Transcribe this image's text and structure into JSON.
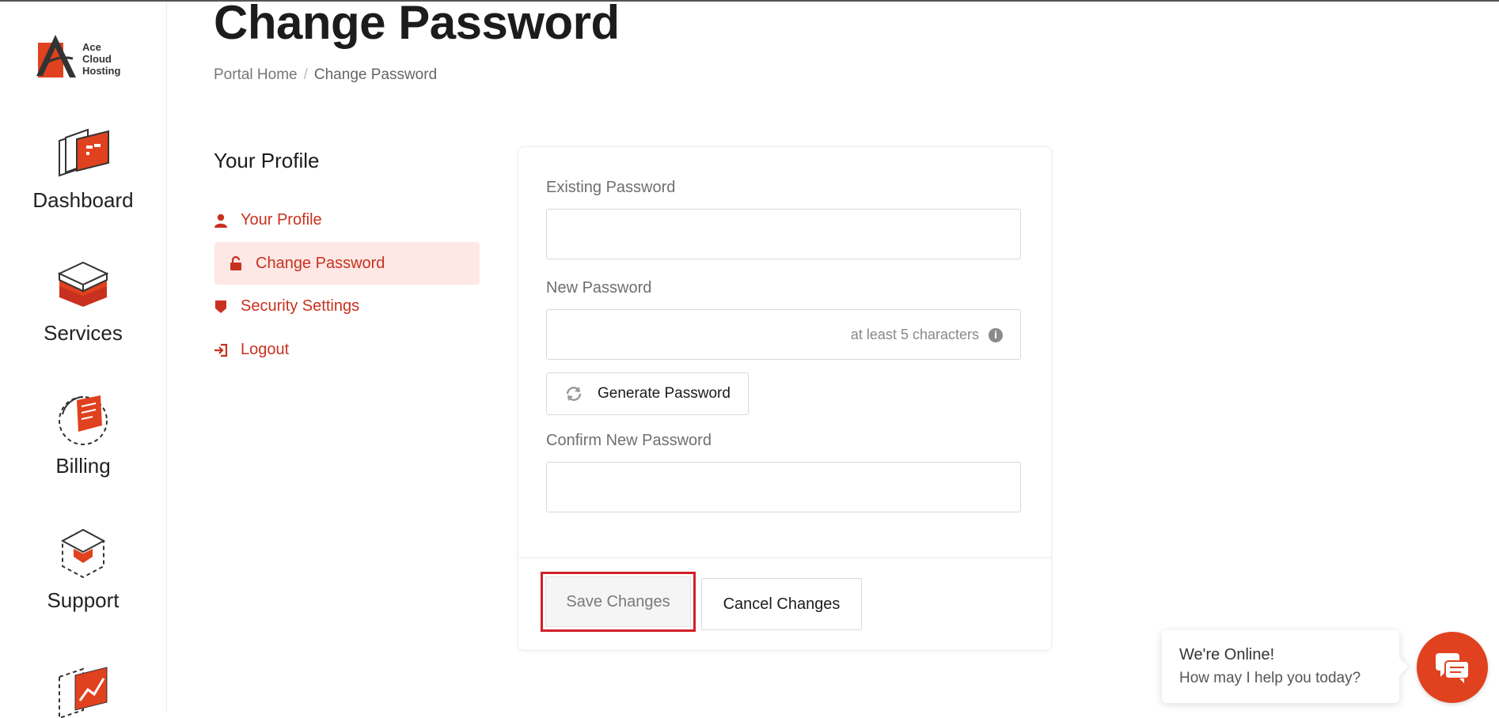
{
  "brand": {
    "logo_lines": [
      "Ace",
      "Cloud",
      "Hosting"
    ],
    "accent_color": "#e0411f"
  },
  "sidebar": {
    "items": [
      {
        "label": "Dashboard",
        "icon": "dashboard-icon"
      },
      {
        "label": "Services",
        "icon": "services-icon"
      },
      {
        "label": "Billing",
        "icon": "billing-icon"
      },
      {
        "label": "Support",
        "icon": "support-icon"
      },
      {
        "label": "",
        "icon": "reports-icon"
      }
    ]
  },
  "header": {
    "title": "Change Password",
    "breadcrumb": [
      "Portal Home",
      "Change Password"
    ]
  },
  "profile_menu": {
    "heading": "Your Profile",
    "items": [
      {
        "label": "Your Profile",
        "icon": "user-icon",
        "active": false
      },
      {
        "label": "Change Password",
        "icon": "lock-icon",
        "active": true
      },
      {
        "label": "Security Settings",
        "icon": "shield-icon",
        "active": false
      },
      {
        "label": "Logout",
        "icon": "logout-icon",
        "active": false
      }
    ]
  },
  "form": {
    "existing_password": {
      "label": "Existing Password",
      "value": ""
    },
    "new_password": {
      "label": "New Password",
      "value": "",
      "hint": "at least 5 characters"
    },
    "generate_button": "Generate Password",
    "confirm_password": {
      "label": "Confirm New Password",
      "value": ""
    },
    "save_button": "Save Changes",
    "cancel_button": "Cancel Changes"
  },
  "chat": {
    "line1": "We're Online!",
    "line2": "How may I help you today?"
  }
}
